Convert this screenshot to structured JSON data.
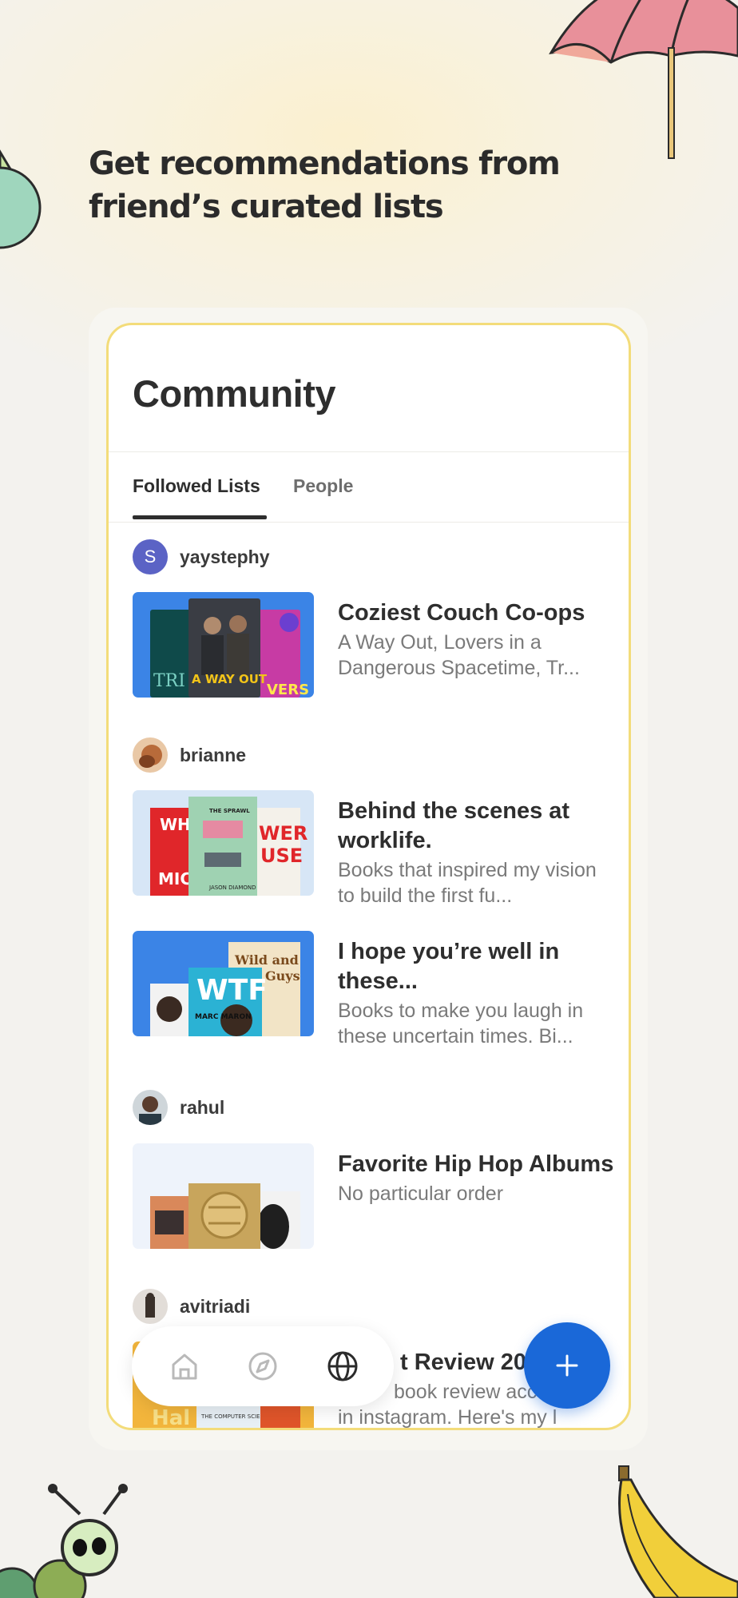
{
  "headline": "Get recommendations from friend’s curated lists",
  "card": {
    "title": "Community",
    "tabs": [
      {
        "label": "Followed Lists",
        "active": true
      },
      {
        "label": "People",
        "active": false
      }
    ]
  },
  "feed": [
    {
      "user": "yaystephy",
      "avatar_letter": "S",
      "lists": [
        {
          "title": "Coziest Couch Co-ops",
          "description": "A Way Out, Lovers in a Dangerous Spacetime, Tr...",
          "cover_texts": [
            "TRI",
            "A WAY OUT",
            "VERS"
          ]
        }
      ]
    },
    {
      "user": "brianne",
      "lists": [
        {
          "title": "Behind the scenes at worklife.",
          "description": "Books that inspired my vision to build the first fu...",
          "cover_texts": [
            "WHO",
            "MICH",
            "THE SPRAWL",
            "JASON DIAMOND",
            "WER",
            "USE"
          ]
        },
        {
          "title": "I hope you’re well in these...",
          "description": "Books to make you laugh in these uncertain times. Bi...",
          "cover_texts": [
            "WTF",
            "MARC MARON",
            "Wild and",
            "Guys"
          ]
        }
      ]
    },
    {
      "user": "rahul",
      "lists": [
        {
          "title": "Favorite Hip Hop Albums",
          "description": "No particular order"
        }
      ]
    },
    {
      "user": "avitriadi",
      "lists": [
        {
          "title": "t Review 20",
          "description": "book review acc",
          "description2": "in instagram. Here's my l",
          "cover_texts": [
            "Hal",
            "THE COMPUTER SCIENCE"
          ]
        }
      ]
    }
  ],
  "nav": {
    "items": [
      {
        "name": "home-icon",
        "active": false
      },
      {
        "name": "compass-icon",
        "active": false
      },
      {
        "name": "globe-icon",
        "active": true
      }
    ]
  },
  "colors": {
    "accent": "#1a68d8",
    "card_border": "#f3dc7a",
    "avatar_s": "#5b63c5"
  }
}
